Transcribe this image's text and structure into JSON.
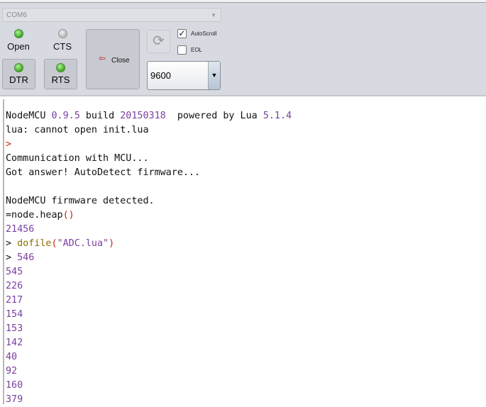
{
  "toolbar": {
    "port": "COM6",
    "indicators": [
      {
        "label": "Open",
        "on": true
      },
      {
        "label": "CTS",
        "on": false
      }
    ],
    "toggles": [
      {
        "label": "DTR",
        "on": true
      },
      {
        "label": "RTS",
        "on": true
      }
    ],
    "close_label": "Close",
    "autoscroll_label": "AutoScroll",
    "autoscroll_checked": true,
    "eol_label": "EOL",
    "eol_checked": false,
    "baud": "9600",
    "check_mark": "✓"
  },
  "console": {
    "lines": [
      [
        {
          "t": "NodeMCU ",
          "c": "txt"
        },
        {
          "t": "0.9.5",
          "c": "num"
        },
        {
          "t": " build ",
          "c": "txt"
        },
        {
          "t": "20150318",
          "c": "num"
        },
        {
          "t": "  powered by Lua ",
          "c": "txt"
        },
        {
          "t": "5.1.4",
          "c": "num"
        }
      ],
      [
        {
          "t": "lua: cannot open init.lua",
          "c": "txt"
        }
      ],
      [
        {
          "t": ">",
          "c": "op"
        }
      ],
      [
        {
          "t": "Communication with MCU...",
          "c": "txt"
        }
      ],
      [
        {
          "t": "Got answer! AutoDetect firmware...",
          "c": "txt"
        }
      ],
      [
        {
          "t": "",
          "c": "txt"
        }
      ],
      [
        {
          "t": "NodeMCU firmware detected.",
          "c": "txt"
        }
      ],
      [
        {
          "t": "=node.heap",
          "c": "txt"
        },
        {
          "t": "()",
          "c": "op"
        }
      ],
      [
        {
          "t": "21456",
          "c": "num"
        }
      ],
      [
        {
          "t": "> ",
          "c": "txt"
        },
        {
          "t": "dofile",
          "c": "fn"
        },
        {
          "t": "(",
          "c": "op"
        },
        {
          "t": "\"ADC.lua\"",
          "c": "str"
        },
        {
          "t": ")",
          "c": "op"
        }
      ],
      [
        {
          "t": "> ",
          "c": "txt"
        },
        {
          "t": "546",
          "c": "num"
        }
      ],
      [
        {
          "t": "545",
          "c": "num"
        }
      ],
      [
        {
          "t": "226",
          "c": "num"
        }
      ],
      [
        {
          "t": "217",
          "c": "num"
        }
      ],
      [
        {
          "t": "154",
          "c": "num"
        }
      ],
      [
        {
          "t": "153",
          "c": "num"
        }
      ],
      [
        {
          "t": "142",
          "c": "num"
        }
      ],
      [
        {
          "t": "40",
          "c": "num"
        }
      ],
      [
        {
          "t": "92",
          "c": "num"
        }
      ],
      [
        {
          "t": "160",
          "c": "num"
        }
      ],
      [
        {
          "t": "379",
          "c": "num"
        }
      ]
    ]
  }
}
